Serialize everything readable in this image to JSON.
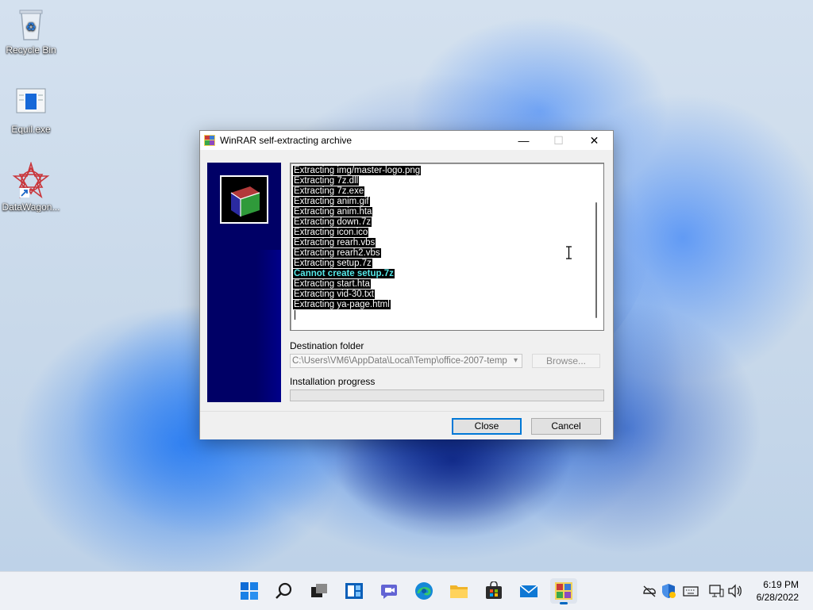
{
  "desktop": {
    "icons": [
      {
        "label": "Recycle Bin",
        "icon": "recycle-bin-icon"
      },
      {
        "label": "Equil.exe",
        "icon": "application-icon"
      },
      {
        "label": "DataWagon...",
        "icon": "shortcut-icon"
      }
    ]
  },
  "window": {
    "title": "WinRAR self-extracting archive",
    "controls": {
      "minimize": "—",
      "maximize": "☐",
      "close": "✕"
    },
    "log_lines": [
      {
        "text": "Extracting img/master-logo.png",
        "warn": false
      },
      {
        "text": "Extracting 7z.dll",
        "warn": false
      },
      {
        "text": "Extracting 7z.exe",
        "warn": false
      },
      {
        "text": "Extracting anim.gif",
        "warn": false
      },
      {
        "text": "Extracting anim.hta",
        "warn": false
      },
      {
        "text": "Extracting down.7z",
        "warn": false
      },
      {
        "text": "Extracting icon.ico",
        "warn": false
      },
      {
        "text": "Extracting rearh.vbs",
        "warn": false
      },
      {
        "text": "Extracting rearh2.vbs",
        "warn": false
      },
      {
        "text": "Extracting setup.7z",
        "warn": false
      },
      {
        "text": "Cannot create setup.7z",
        "warn": true
      },
      {
        "text": "Extracting start.hta",
        "warn": false
      },
      {
        "text": "Extracting vid-30.txt",
        "warn": false
      },
      {
        "text": "Extracting ya-page.html",
        "warn": false
      }
    ],
    "destination_label": "Destination folder",
    "destination_value": "C:\\Users\\VM6\\AppData\\Local\\Temp\\office-2007-temp",
    "browse_label": "Browse...",
    "progress_label": "Installation progress",
    "progress_value": 0,
    "close_label": "Close",
    "cancel_label": "Cancel",
    "colors": {
      "sidebar": "#000066",
      "log_highlight": "#000000",
      "warn_text": "#56e8e8"
    }
  },
  "taskbar": {
    "items": [
      "start-icon",
      "search-icon",
      "task-view-icon",
      "widgets-icon",
      "chat-icon",
      "edge-icon",
      "file-explorer-icon",
      "store-icon",
      "mail-icon",
      "winrar-icon"
    ],
    "tray": [
      "network-offline-icon",
      "defender-icon",
      "keyboard-icon",
      "display-icon",
      "volume-icon"
    ],
    "time": "6:19 PM",
    "date": "6/28/2022"
  }
}
